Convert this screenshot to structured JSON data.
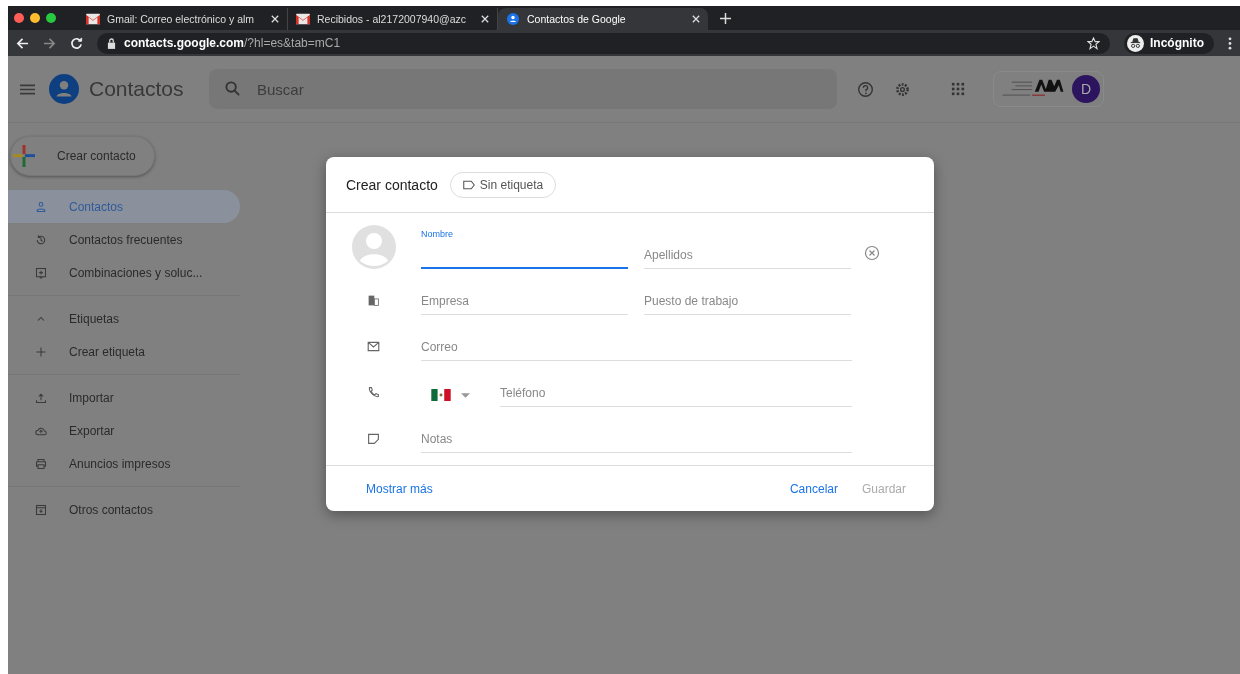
{
  "browser": {
    "tabs": [
      {
        "title": "Gmail: Correo electrónico y alm",
        "selected": false
      },
      {
        "title": "Recibidos - al2172007940@azc",
        "selected": false
      },
      {
        "title": "Contactos de Google",
        "selected": true
      }
    ],
    "url_host": "contacts.google.com",
    "url_path": "/?hl=es&tab=mC1",
    "profile": "Incógnito"
  },
  "app": {
    "title": "Contactos",
    "search": {
      "placeholder": "Buscar"
    },
    "account_initial": "D"
  },
  "create_button": "Crear contacto",
  "nav": [
    [
      {
        "label": "Contactos",
        "selected": true
      },
      {
        "label": "Contactos frecuentes",
        "selected": false
      },
      {
        "label": "Combinaciones y soluc...",
        "selected": false
      }
    ],
    [
      {
        "label": "Etiquetas",
        "selected": false
      },
      {
        "label": "Crear etiqueta",
        "selected": false
      }
    ],
    [
      {
        "label": "Importar",
        "selected": false
      },
      {
        "label": "Exportar",
        "selected": false
      },
      {
        "label": "Anuncios impresos",
        "selected": false
      }
    ],
    [
      {
        "label": "Otros contactos",
        "selected": false
      }
    ]
  ],
  "dialog": {
    "title": "Crear contacto",
    "label_chip": "Sin etiqueta",
    "rows": [
      {
        "fields": [
          {
            "label": "Nombre",
            "focused": true
          },
          {
            "placeholder": "Apellidos",
            "focused": false
          }
        ]
      },
      {
        "fields": [
          {
            "placeholder": "Empresa",
            "focused": false
          },
          {
            "placeholder": "Puesto de trabajo",
            "focused": false
          }
        ]
      },
      {
        "fields": [
          {
            "placeholder": "Correo",
            "focused": false
          }
        ]
      },
      {
        "country_picker": true,
        "fields": [
          {
            "placeholder": "Teléfono",
            "focused": false
          }
        ]
      },
      {
        "fields": [
          {
            "placeholder": "Notas",
            "focused": false
          }
        ]
      }
    ],
    "more_link": "Mostrar más",
    "cancel": "Cancelar",
    "save": {
      "label": "Guardar",
      "disabled": true
    }
  }
}
